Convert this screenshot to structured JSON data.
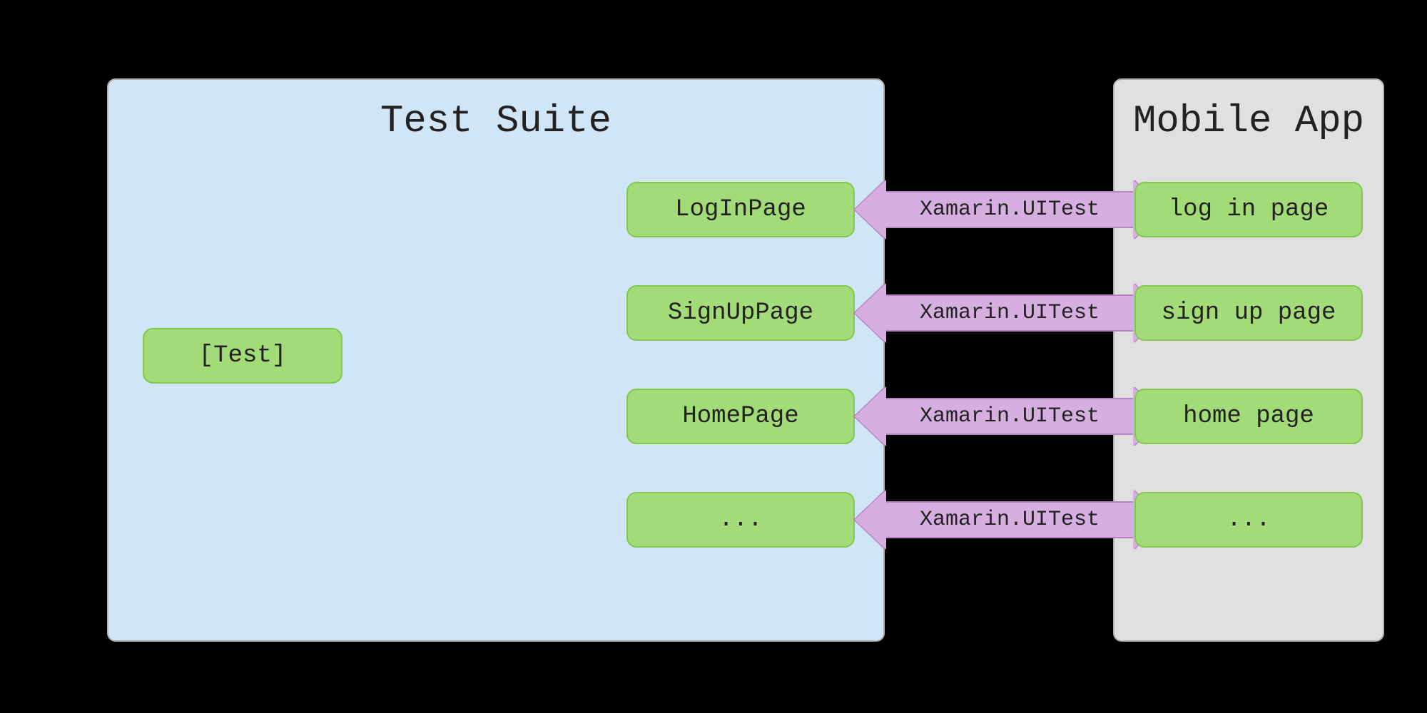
{
  "testSuite": {
    "title": "Test Suite",
    "root": "[Test]",
    "pages": [
      "LogInPage",
      "SignUpPage",
      "HomePage",
      "..."
    ]
  },
  "connectors": [
    "Xamarin.UITest",
    "Xamarin.UITest",
    "Xamarin.UITest",
    "Xamarin.UITest"
  ],
  "mobileApp": {
    "title": "Mobile App",
    "pages": [
      "log in page",
      "sign up page",
      "home page",
      "..."
    ]
  },
  "colors": {
    "panelBlue": "#d0e5f5",
    "panelGray": "#e0e0e0",
    "nodeGreen": "#a2db77",
    "arrowPurple": "#d7aee0"
  }
}
